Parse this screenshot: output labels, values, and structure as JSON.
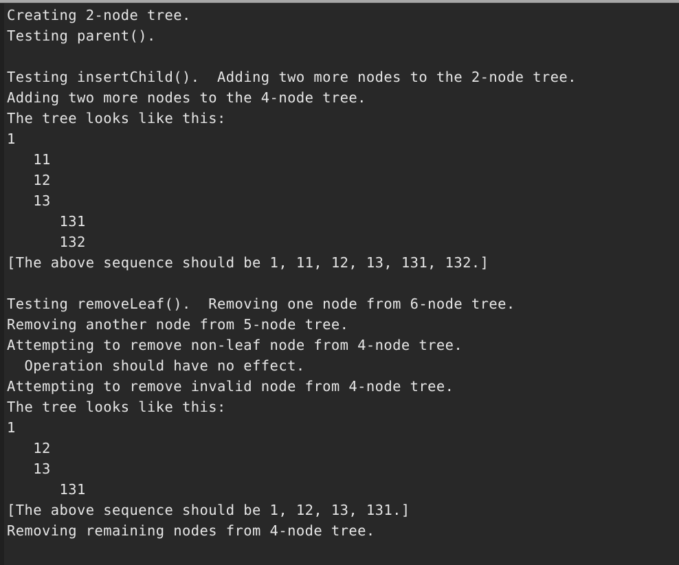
{
  "terminal": {
    "background_color": "#282828",
    "text_color": "#e6e6e6",
    "chrome_bar_color": "#a8a8a8",
    "gutter_color": "#202020",
    "lines": [
      {
        "id": "line-1",
        "text": "Creating 2-node tree."
      },
      {
        "id": "line-2",
        "text": "Testing parent()."
      },
      {
        "id": "line-3",
        "text": ""
      },
      {
        "id": "line-4",
        "text": "Testing insertChild().  Adding two more nodes to the 2-node tree."
      },
      {
        "id": "line-5",
        "text": "Adding two more nodes to the 4-node tree."
      },
      {
        "id": "line-6",
        "text": "The tree looks like this:"
      },
      {
        "id": "line-7",
        "text": "1"
      },
      {
        "id": "line-8",
        "text": "   11"
      },
      {
        "id": "line-9",
        "text": "   12"
      },
      {
        "id": "line-10",
        "text": "   13"
      },
      {
        "id": "line-11",
        "text": "      131"
      },
      {
        "id": "line-12",
        "text": "      132"
      },
      {
        "id": "line-13",
        "text": "[The above sequence should be 1, 11, 12, 13, 131, 132.]"
      },
      {
        "id": "line-14",
        "text": ""
      },
      {
        "id": "line-15",
        "text": "Testing removeLeaf().  Removing one node from 6-node tree."
      },
      {
        "id": "line-16",
        "text": "Removing another node from 5-node tree."
      },
      {
        "id": "line-17",
        "text": "Attempting to remove non-leaf node from 4-node tree."
      },
      {
        "id": "line-18",
        "text": "  Operation should have no effect."
      },
      {
        "id": "line-19",
        "text": "Attempting to remove invalid node from 4-node tree."
      },
      {
        "id": "line-20",
        "text": "The tree looks like this:"
      },
      {
        "id": "line-21",
        "text": "1"
      },
      {
        "id": "line-22",
        "text": "   12"
      },
      {
        "id": "line-23",
        "text": "   13"
      },
      {
        "id": "line-24",
        "text": "      131"
      },
      {
        "id": "line-25",
        "text": "[The above sequence should be 1, 12, 13, 131.]"
      },
      {
        "id": "line-26",
        "text": "Removing remaining nodes from 4-node tree."
      }
    ]
  }
}
